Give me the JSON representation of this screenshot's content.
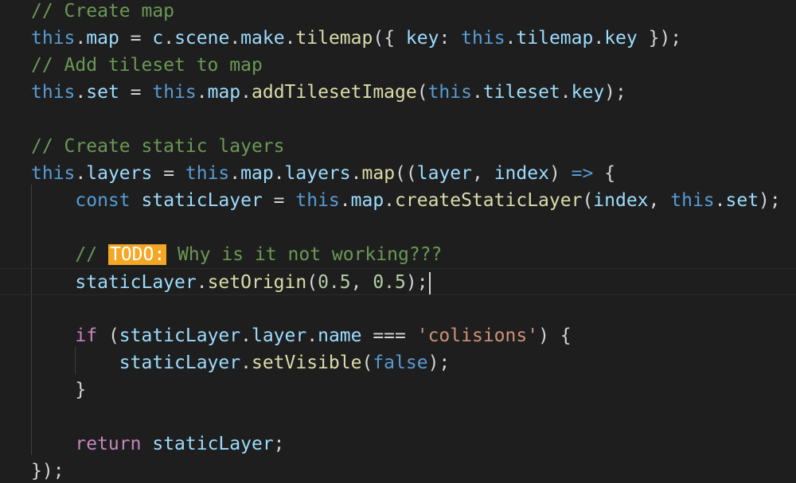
{
  "lines": [
    [
      {
        "t": "// Create map",
        "c": "comment"
      }
    ],
    [
      {
        "t": "this",
        "c": "this"
      },
      {
        "t": ".",
        "c": "punc"
      },
      {
        "t": "map",
        "c": "prop"
      },
      {
        "t": " = ",
        "c": "op"
      },
      {
        "t": "c",
        "c": "var"
      },
      {
        "t": ".",
        "c": "punc"
      },
      {
        "t": "scene",
        "c": "prop"
      },
      {
        "t": ".",
        "c": "punc"
      },
      {
        "t": "make",
        "c": "prop"
      },
      {
        "t": ".",
        "c": "punc"
      },
      {
        "t": "tilemap",
        "c": "fn"
      },
      {
        "t": "({ ",
        "c": "punc"
      },
      {
        "t": "key",
        "c": "prop"
      },
      {
        "t": ": ",
        "c": "punc"
      },
      {
        "t": "this",
        "c": "this"
      },
      {
        "t": ".",
        "c": "punc"
      },
      {
        "t": "tilemap",
        "c": "prop"
      },
      {
        "t": ".",
        "c": "punc"
      },
      {
        "t": "key",
        "c": "prop"
      },
      {
        "t": " });",
        "c": "punc"
      }
    ],
    [
      {
        "t": "// Add tileset to map",
        "c": "comment"
      }
    ],
    [
      {
        "t": "this",
        "c": "this"
      },
      {
        "t": ".",
        "c": "punc"
      },
      {
        "t": "set",
        "c": "prop"
      },
      {
        "t": " = ",
        "c": "op"
      },
      {
        "t": "this",
        "c": "this"
      },
      {
        "t": ".",
        "c": "punc"
      },
      {
        "t": "map",
        "c": "prop"
      },
      {
        "t": ".",
        "c": "punc"
      },
      {
        "t": "addTilesetImage",
        "c": "fn"
      },
      {
        "t": "(",
        "c": "punc"
      },
      {
        "t": "this",
        "c": "this"
      },
      {
        "t": ".",
        "c": "punc"
      },
      {
        "t": "tileset",
        "c": "prop"
      },
      {
        "t": ".",
        "c": "punc"
      },
      {
        "t": "key",
        "c": "prop"
      },
      {
        "t": ");",
        "c": "punc"
      }
    ],
    [],
    [
      {
        "t": "// Create static layers",
        "c": "comment"
      }
    ],
    [
      {
        "t": "this",
        "c": "this"
      },
      {
        "t": ".",
        "c": "punc"
      },
      {
        "t": "layers",
        "c": "prop"
      },
      {
        "t": " = ",
        "c": "op"
      },
      {
        "t": "this",
        "c": "this"
      },
      {
        "t": ".",
        "c": "punc"
      },
      {
        "t": "map",
        "c": "prop"
      },
      {
        "t": ".",
        "c": "punc"
      },
      {
        "t": "layers",
        "c": "prop"
      },
      {
        "t": ".",
        "c": "punc"
      },
      {
        "t": "map",
        "c": "fn"
      },
      {
        "t": "((",
        "c": "punc"
      },
      {
        "t": "layer",
        "c": "var"
      },
      {
        "t": ", ",
        "c": "punc"
      },
      {
        "t": "index",
        "c": "var"
      },
      {
        "t": ") ",
        "c": "punc"
      },
      {
        "t": "=>",
        "c": "kw"
      },
      {
        "t": " {",
        "c": "punc"
      }
    ],
    [
      {
        "t": "    ",
        "c": "punc"
      },
      {
        "t": "const",
        "c": "kw"
      },
      {
        "t": " ",
        "c": "punc"
      },
      {
        "t": "staticLayer",
        "c": "var"
      },
      {
        "t": " = ",
        "c": "op"
      },
      {
        "t": "this",
        "c": "this"
      },
      {
        "t": ".",
        "c": "punc"
      },
      {
        "t": "map",
        "c": "prop"
      },
      {
        "t": ".",
        "c": "punc"
      },
      {
        "t": "createStaticLayer",
        "c": "fn"
      },
      {
        "t": "(",
        "c": "punc"
      },
      {
        "t": "index",
        "c": "var"
      },
      {
        "t": ", ",
        "c": "punc"
      },
      {
        "t": "this",
        "c": "this"
      },
      {
        "t": ".",
        "c": "punc"
      },
      {
        "t": "set",
        "c": "prop"
      },
      {
        "t": ");",
        "c": "punc"
      }
    ],
    [],
    [
      {
        "t": "    // ",
        "c": "comment"
      },
      {
        "t": "TODO:",
        "c": "todo"
      },
      {
        "t": " Why is it not working???",
        "c": "comment"
      }
    ],
    [
      {
        "t": "    ",
        "c": "punc"
      },
      {
        "t": "staticLayer",
        "c": "var"
      },
      {
        "t": ".",
        "c": "punc"
      },
      {
        "t": "setOrigin",
        "c": "fn"
      },
      {
        "t": "(",
        "c": "punc"
      },
      {
        "t": "0.5",
        "c": "num"
      },
      {
        "t": ", ",
        "c": "punc"
      },
      {
        "t": "0.5",
        "c": "num"
      },
      {
        "t": ");",
        "c": "punc"
      }
    ],
    [],
    [
      {
        "t": "    ",
        "c": "punc"
      },
      {
        "t": "if",
        "c": "ctrl"
      },
      {
        "t": " (",
        "c": "punc"
      },
      {
        "t": "staticLayer",
        "c": "var"
      },
      {
        "t": ".",
        "c": "punc"
      },
      {
        "t": "layer",
        "c": "prop"
      },
      {
        "t": ".",
        "c": "punc"
      },
      {
        "t": "name",
        "c": "prop"
      },
      {
        "t": " === ",
        "c": "op"
      },
      {
        "t": "'colisions'",
        "c": "str"
      },
      {
        "t": ") {",
        "c": "punc"
      }
    ],
    [
      {
        "t": "        ",
        "c": "punc"
      },
      {
        "t": "staticLayer",
        "c": "var"
      },
      {
        "t": ".",
        "c": "punc"
      },
      {
        "t": "setVisible",
        "c": "fn"
      },
      {
        "t": "(",
        "c": "punc"
      },
      {
        "t": "false",
        "c": "kw"
      },
      {
        "t": ");",
        "c": "punc"
      }
    ],
    [
      {
        "t": "    }",
        "c": "punc"
      }
    ],
    [],
    [
      {
        "t": "    ",
        "c": "punc"
      },
      {
        "t": "return",
        "c": "ctrl"
      },
      {
        "t": " ",
        "c": "punc"
      },
      {
        "t": "staticLayer",
        "c": "var"
      },
      {
        "t": ";",
        "c": "punc"
      }
    ],
    [
      {
        "t": "});",
        "c": "punc"
      }
    ]
  ],
  "cursor_line": 11
}
